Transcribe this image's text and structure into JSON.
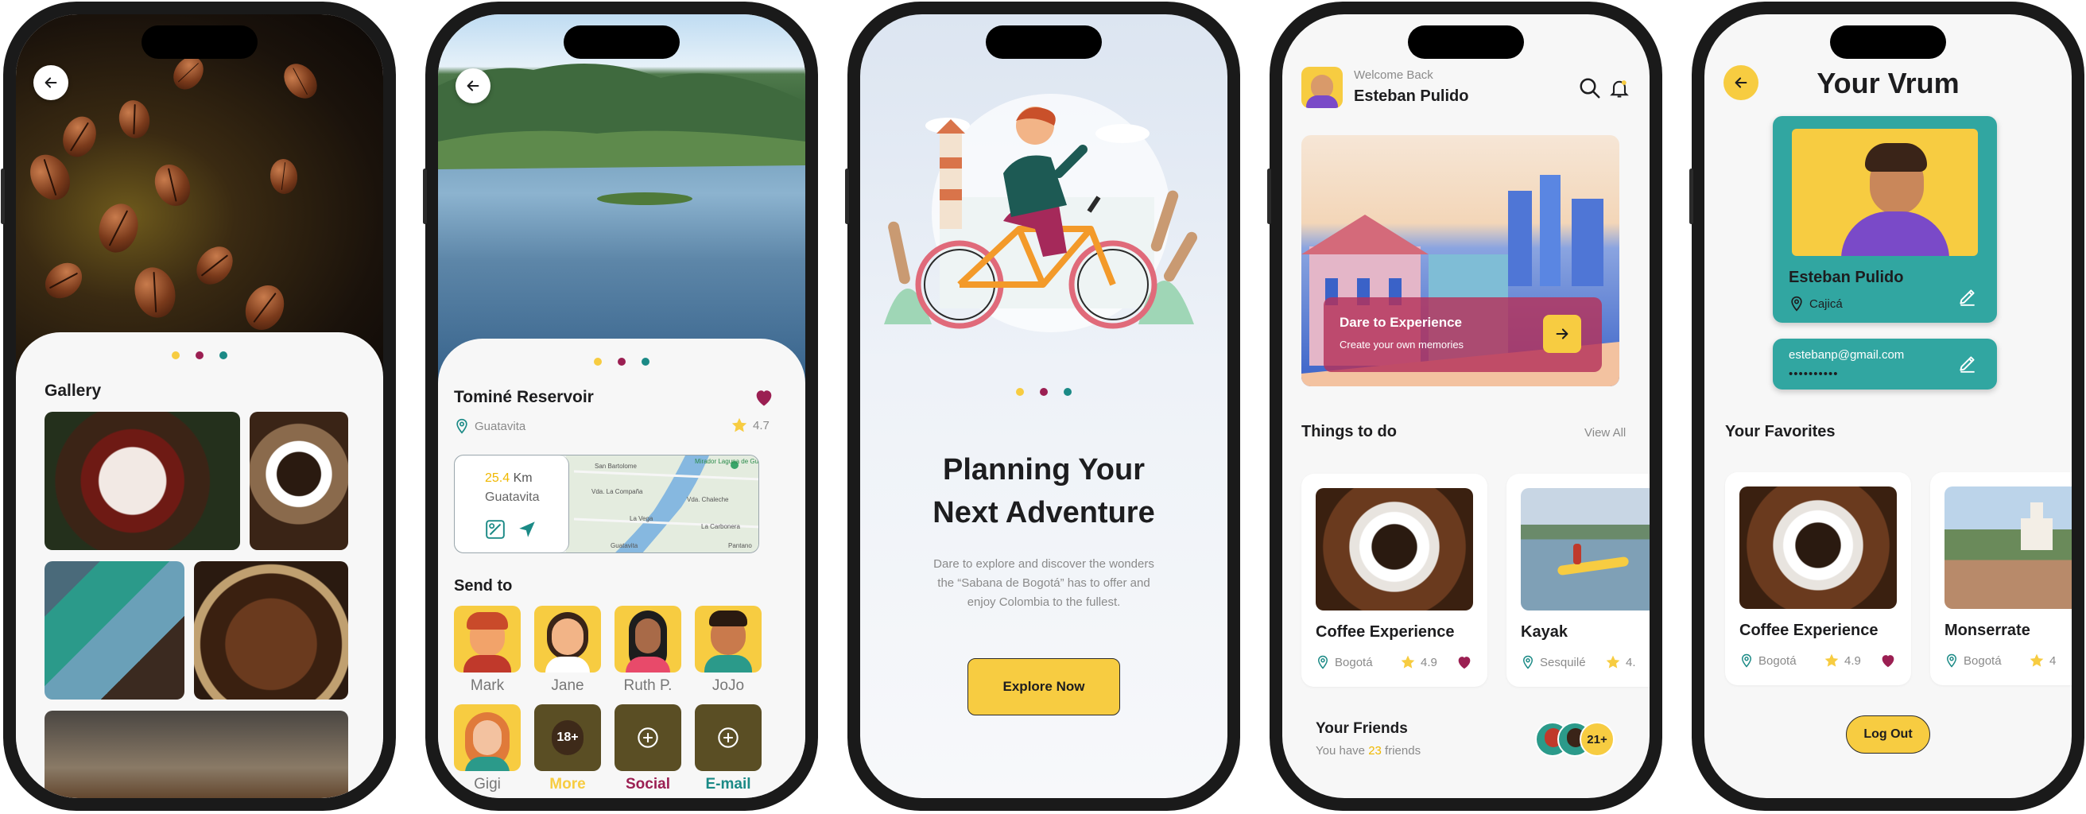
{
  "colors": {
    "yellow": "#f7cc41",
    "maroon": "#9b1f52",
    "teal": "#1b8a86",
    "dark": "#1d1d1f",
    "gray": "#8a8a8a"
  },
  "gallery": {
    "title": "Gallery"
  },
  "detail": {
    "place": "Tominé Reservoir",
    "location": "Guatavita",
    "rating": "4.7",
    "distance_value": "25.4",
    "distance_unit": "Km",
    "distance_place": "Guatavita",
    "map_labels": [
      "San Bartolome",
      "Mirador Laguna de Guatavita",
      "Vda. La Compaña",
      "Vda. Chaleche",
      "La Vega",
      "Guatavita",
      "La Carbonera",
      "Pantano"
    ],
    "send_to_title": "Send to",
    "contacts": [
      {
        "name": "Mark",
        "color": "#f7cc41"
      },
      {
        "name": "Jane",
        "color": "#f7cc41"
      },
      {
        "name": "Ruth P.",
        "color": "#f7cc41"
      },
      {
        "name": "JoJo",
        "color": "#f7cc41"
      },
      {
        "name": "Gigi",
        "color": "#f7cc41"
      }
    ],
    "age_badge": "18+",
    "more_label": "More",
    "social_label": "Social",
    "email_label": "E-mail"
  },
  "onboarding": {
    "title_line1": "Planning Your",
    "title_line2": "Next Adventure",
    "desc_line1": "Dare to explore and discover the wonders",
    "desc_line2": "the “Sabana de Bogotá” has to offer and",
    "desc_line3": "enjoy Colombia to the fullest.",
    "button": "Explore Now"
  },
  "home": {
    "welcome": "Welcome Back",
    "user": "Esteban Pulido",
    "banner_title": "Dare to Experience",
    "banner_sub": "Create your own memories",
    "things_title": "Things to do",
    "view_all": "View All",
    "cards": [
      {
        "title": "Coffee Experience",
        "location": "Bogotá",
        "rating": "4.9"
      },
      {
        "title": "Kayak",
        "location": "Sesquilé",
        "rating": "4."
      }
    ],
    "friends_title": "Your Friends",
    "friends_prefix": "You have ",
    "friends_count": "23",
    "friends_suffix": " friends",
    "friends_badge": "21+"
  },
  "profile": {
    "title": "Your Vrum",
    "name": "Esteban Pulido",
    "town": "Cajicá",
    "email": "estebanp@gmail.com",
    "password": "••••••••••",
    "favorites_title": "Your Favorites",
    "favorites": [
      {
        "title": "Coffee Experience",
        "location": "Bogotá",
        "rating": "4.9"
      },
      {
        "title": "Monserrate",
        "location": "Bogotá",
        "rating": "4"
      }
    ],
    "logout": "Log Out"
  }
}
